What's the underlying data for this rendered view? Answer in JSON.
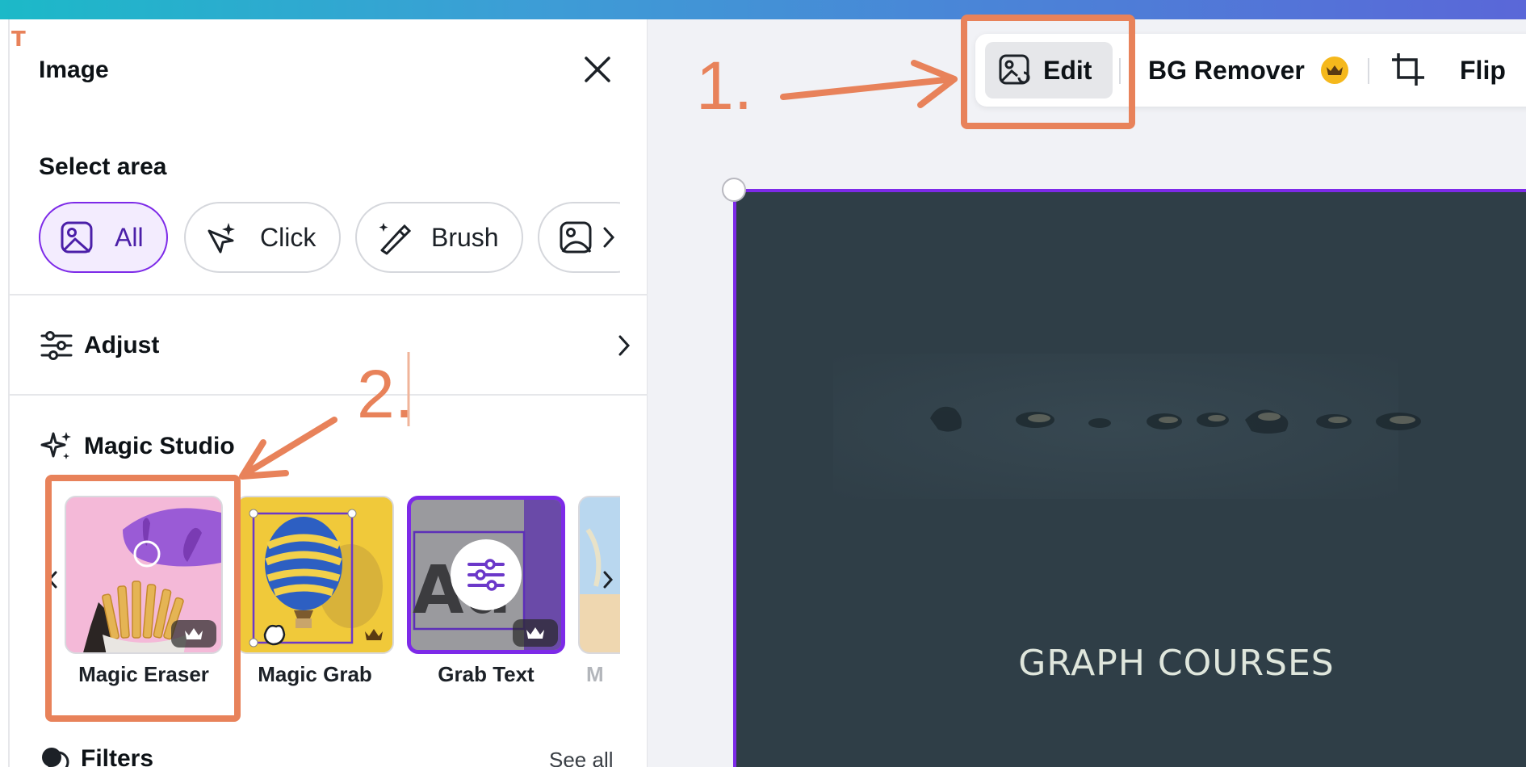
{
  "panel": {
    "title": "Image",
    "t_mark": "T",
    "select_area": {
      "label": "Select area",
      "chips": [
        {
          "label": "All",
          "icon": "image-icon",
          "active": true
        },
        {
          "label": "Click",
          "icon": "sparkle-cursor-icon",
          "active": false
        },
        {
          "label": "Brush",
          "icon": "magic-brush-icon",
          "active": false
        },
        {
          "label": "",
          "icon": "image-icon",
          "active": false
        }
      ]
    },
    "adjust": {
      "label": "Adjust"
    },
    "magic_studio": {
      "label": "Magic Studio",
      "tiles": [
        {
          "label": "Magic Eraser",
          "premium": true
        },
        {
          "label": "Magic Grab",
          "premium": true
        },
        {
          "label": "Grab Text",
          "premium": true
        },
        {
          "label": "M",
          "premium": false
        }
      ]
    },
    "filters": {
      "label": "Filters",
      "see_all": "See all"
    }
  },
  "toolbar": {
    "edit": "Edit",
    "bg_remover": "BG Remover",
    "flip": "Flip"
  },
  "canvas": {
    "text": "GRAPH COURSES"
  },
  "annotations": {
    "step1": "1.",
    "step2": "2.",
    "color": "#e8825a"
  },
  "colors": {
    "accent": "#7d2ae8",
    "premium_crown": "#f5b81c",
    "canvas_bg": "#2f3e47"
  }
}
